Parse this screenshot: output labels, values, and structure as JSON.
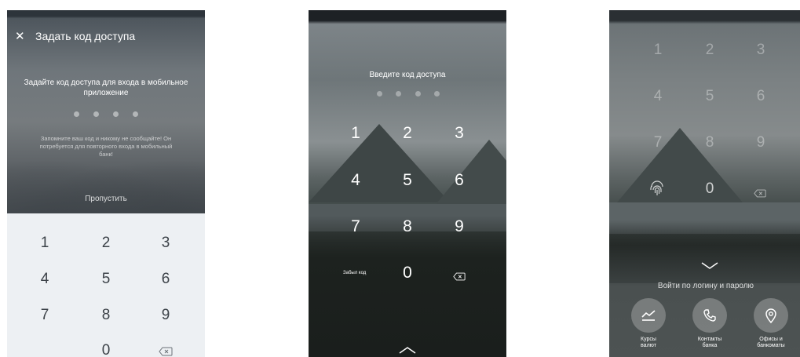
{
  "screen1": {
    "close_icon": "close-icon",
    "title": "Задать код доступа",
    "prompt": "Задайте код доступа для входа в мобильное приложение",
    "note": "Запомните ваш код и никому не сообщайте! Он потребуется для повторного входа в мобильный банк!",
    "skip": "Пропустить",
    "keys": [
      "1",
      "2",
      "3",
      "4",
      "5",
      "6",
      "7",
      "8",
      "9",
      "0"
    ],
    "backspace_icon": "backspace-icon"
  },
  "screen2": {
    "prompt": "Введите код доступа",
    "keys": [
      "1",
      "2",
      "3",
      "4",
      "5",
      "6",
      "7",
      "8",
      "9",
      "0"
    ],
    "forgot": "Забыл код",
    "backspace_icon": "backspace-icon",
    "chevron_icon": "chevron-up-icon"
  },
  "screen3": {
    "keys": [
      "1",
      "2",
      "3",
      "4",
      "5",
      "6",
      "7",
      "8",
      "9",
      "0"
    ],
    "fingerprint_icon": "fingerprint-icon",
    "backspace_icon": "backspace-icon",
    "chevron_icon": "chevron-down-icon",
    "login_link": "Войти по логину и паролю",
    "actions": [
      {
        "label_line1": "Курсы",
        "label_line2": "валют",
        "icon": "chart-icon"
      },
      {
        "label_line1": "Контакты",
        "label_line2": "банка",
        "icon": "phone-icon"
      },
      {
        "label_line1": "Офисы и",
        "label_line2": "банкоматы",
        "icon": "location-pin-icon"
      }
    ]
  }
}
